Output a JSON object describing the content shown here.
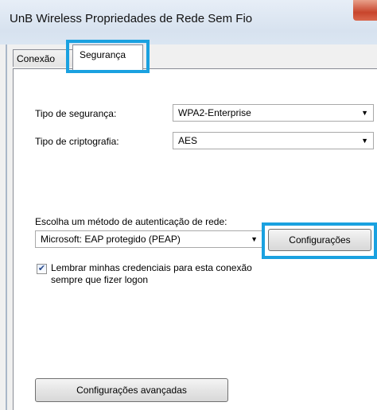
{
  "window": {
    "title": "UnB Wireless Propriedades de Rede Sem Fio"
  },
  "tabs": [
    {
      "label": "Conexão"
    },
    {
      "label": "Segurança"
    }
  ],
  "security": {
    "type_label": "Tipo de segurança:",
    "type_value": "WPA2-Enterprise",
    "encryption_label": "Tipo de criptografia:",
    "encryption_value": "AES"
  },
  "auth": {
    "method_label": "Escolha um método de autenticação de rede:",
    "method_value": "Microsoft: EAP protegido (PEAP)",
    "settings_button": "Configurações",
    "remember_line1": "Lembrar minhas credenciais para esta conexão",
    "remember_line2": "sempre que fizer logon",
    "remember_checked": true
  },
  "advanced_button": "Configurações avançadas",
  "colors": {
    "highlight": "#1aa1e0"
  }
}
